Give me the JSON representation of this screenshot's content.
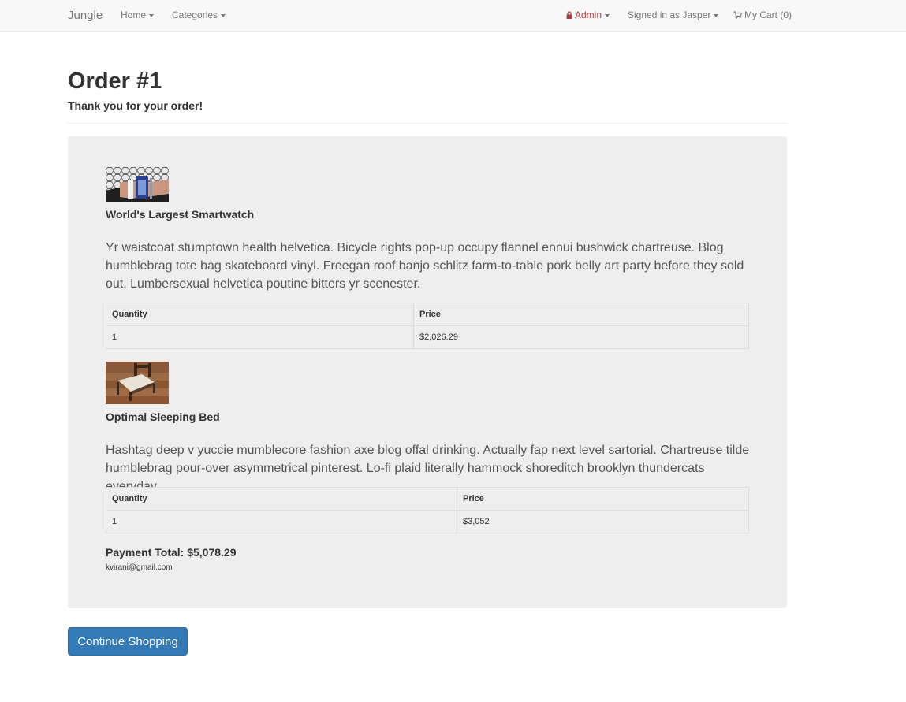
{
  "navbar": {
    "brand": "Jungle",
    "home_label": "Home",
    "categories_label": "Categories",
    "admin_label": "Admin",
    "signed_in_label": "Signed in as Jasper",
    "cart_label": "My Cart (0)",
    "icons": {
      "admin": "lock-icon",
      "cart": "cart-icon"
    },
    "colors": {
      "admin": "#a94442",
      "background": "#f8f8f8"
    }
  },
  "order": {
    "title": "Order #1",
    "thanks": "Thank you for your order!",
    "table_headers": {
      "quantity": "Quantity",
      "price": "Price"
    },
    "items": [
      {
        "name": "World's Largest Smartwatch",
        "description": "Yr waistcoat stumptown health helvetica. Bicycle rights pop-up occupy flannel ennui bushwick chartreuse. Blog humblebrag tote bag skateboard vinyl. Freegan roof banjo schlitz farm-to-table pork belly art party before they sold out. Lumbersexual helvetica poutine bitters yr scenester.",
        "quantity": "1",
        "price": "$2,026.29"
      },
      {
        "name": "Optimal Sleeping Bed",
        "description": "Hashtag deep v yuccie mumblecore fashion axe blog offal drinking. Actually fap next level sartorial. Chartreuse tilde humblebrag pour-over asymmetrical pinterest. Lo-fi plaid literally hammock shoreditch brooklyn thundercats everyday.",
        "quantity": "1",
        "price": "$3,052"
      }
    ],
    "payment_total": "Payment Total: $5,078.29",
    "email": "kvirani@gmail.com"
  },
  "actions": {
    "continue_label": "Continue Shopping",
    "button_color": "#337ab7"
  }
}
